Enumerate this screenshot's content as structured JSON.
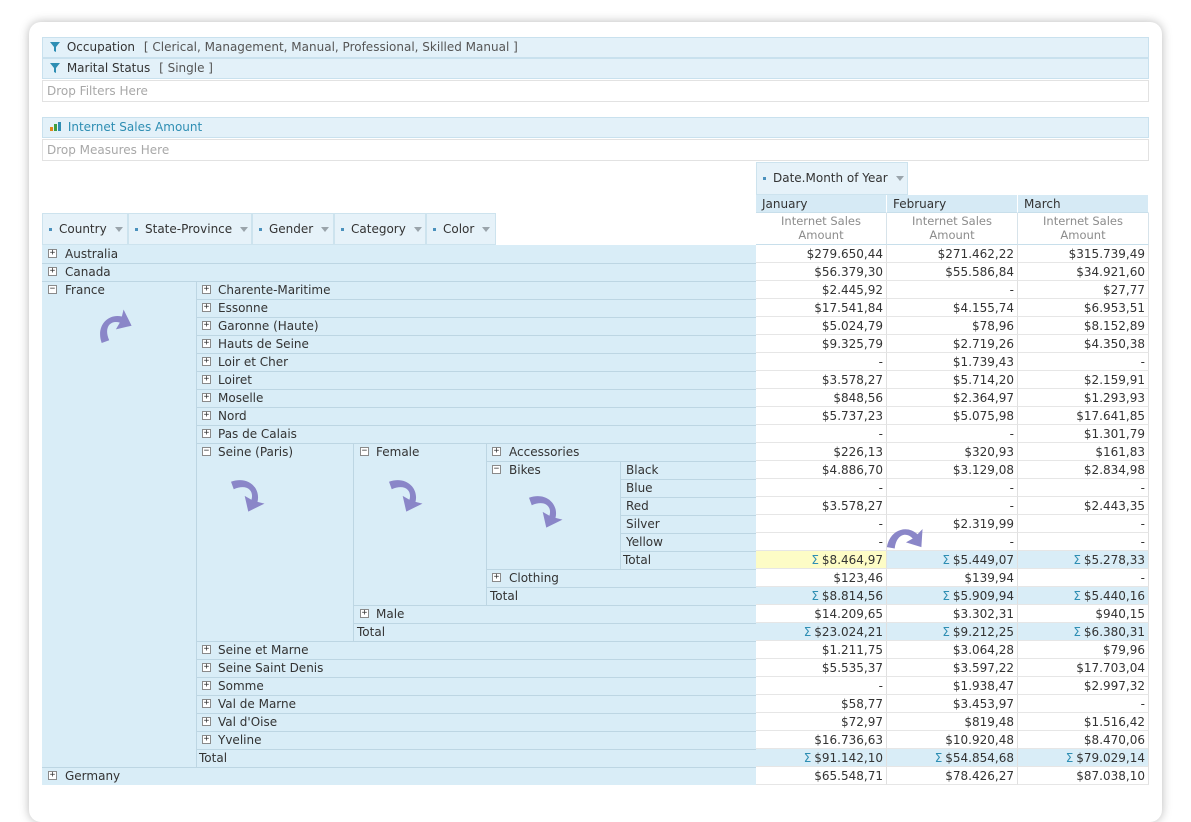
{
  "filters": [
    {
      "name": "Occupation",
      "value": "[ Clerical, Management, Manual, Professional, Skilled Manual ]"
    },
    {
      "name": "Marital Status",
      "value": "[ Single ]"
    }
  ],
  "drop_filters": "Drop Filters Here",
  "measure": "Internet Sales Amount",
  "drop_measures": "Drop Measures Here",
  "column_field": "Date.Month of Year",
  "row_fields": [
    "Country",
    "State-Province",
    "Gender",
    "Category",
    "Color"
  ],
  "months": [
    "January",
    "February",
    "March"
  ],
  "measure_header": [
    "Internet Sales",
    "Amount"
  ],
  "countries": [
    "Australia",
    "Canada",
    "France",
    "Germany"
  ],
  "states_before": [
    "Charente-Maritime",
    "Essonne",
    "Garonne (Haute)",
    "Hauts de Seine",
    "Loir et Cher",
    "Loiret",
    "Moselle",
    "Nord",
    "Pas de Calais"
  ],
  "seine": "Seine (Paris)",
  "states_after": [
    "Seine et Marne",
    "Seine Saint Denis",
    "Somme",
    "Val de Marne",
    "Val d'Oise",
    "Yveline"
  ],
  "genders": [
    "Female",
    "Male"
  ],
  "categories": [
    "Accessories",
    "Bikes",
    "Clothing"
  ],
  "colors": [
    "Black",
    "Blue",
    "Red",
    "Silver",
    "Yellow"
  ],
  "total_label": "Total",
  "sigma": "Σ",
  "rows": [
    [
      "$279.650,44",
      "$271.462,22",
      "$315.739,49"
    ],
    [
      "$56.379,30",
      "$55.586,84",
      "$34.921,60"
    ],
    [
      "$2.445,92",
      "-",
      "$27,77"
    ],
    [
      "$17.541,84",
      "$4.155,74",
      "$6.953,51"
    ],
    [
      "$5.024,79",
      "$78,96",
      "$8.152,89"
    ],
    [
      "$9.325,79",
      "$2.719,26",
      "$4.350,38"
    ],
    [
      "-",
      "$1.739,43",
      "-"
    ],
    [
      "$3.578,27",
      "$5.714,20",
      "$2.159,91"
    ],
    [
      "$848,56",
      "$2.364,97",
      "$1.293,93"
    ],
    [
      "$5.737,23",
      "$5.075,98",
      "$17.641,85"
    ],
    [
      "-",
      "-",
      "$1.301,79"
    ],
    [
      "$226,13",
      "$320,93",
      "$161,83"
    ],
    [
      "$4.886,70",
      "$3.129,08",
      "$2.834,98"
    ],
    [
      "-",
      "-",
      "-"
    ],
    [
      "$3.578,27",
      "-",
      "$2.443,35"
    ],
    [
      "-",
      "$2.319,99",
      "-"
    ],
    [
      "-",
      "-",
      "-"
    ],
    [
      "$8.464,97",
      "$5.449,07",
      "$5.278,33"
    ],
    [
      "$123,46",
      "$139,94",
      "-"
    ],
    [
      "$8.814,56",
      "$5.909,94",
      "$5.440,16"
    ],
    [
      "$14.209,65",
      "$3.302,31",
      "$940,15"
    ],
    [
      "$23.024,21",
      "$9.212,25",
      "$6.380,31"
    ],
    [
      "$1.211,75",
      "$3.064,28",
      "$79,96"
    ],
    [
      "$5.535,37",
      "$3.597,22",
      "$17.703,04"
    ],
    [
      "-",
      "$1.938,47",
      "$2.997,32"
    ],
    [
      "$58,77",
      "$3.453,97",
      "-"
    ],
    [
      "$72,97",
      "$819,48",
      "$1.516,42"
    ],
    [
      "$16.736,63",
      "$10.920,48",
      "$8.470,06"
    ],
    [
      "$91.142,10",
      "$54.854,68",
      "$79.029,14"
    ],
    [
      "$65.548,71",
      "$78.426,27",
      "$87.038,10"
    ]
  ],
  "total_rows": [
    17,
    19,
    21,
    28
  ],
  "selected_cell": {
    "row": 17,
    "col": 0
  },
  "colors_accent": {
    "header_bg": "#e3f1f9",
    "row_bg": "#d9edf7",
    "selected": "#fdfcc6",
    "arrow": "#8a86c8"
  }
}
